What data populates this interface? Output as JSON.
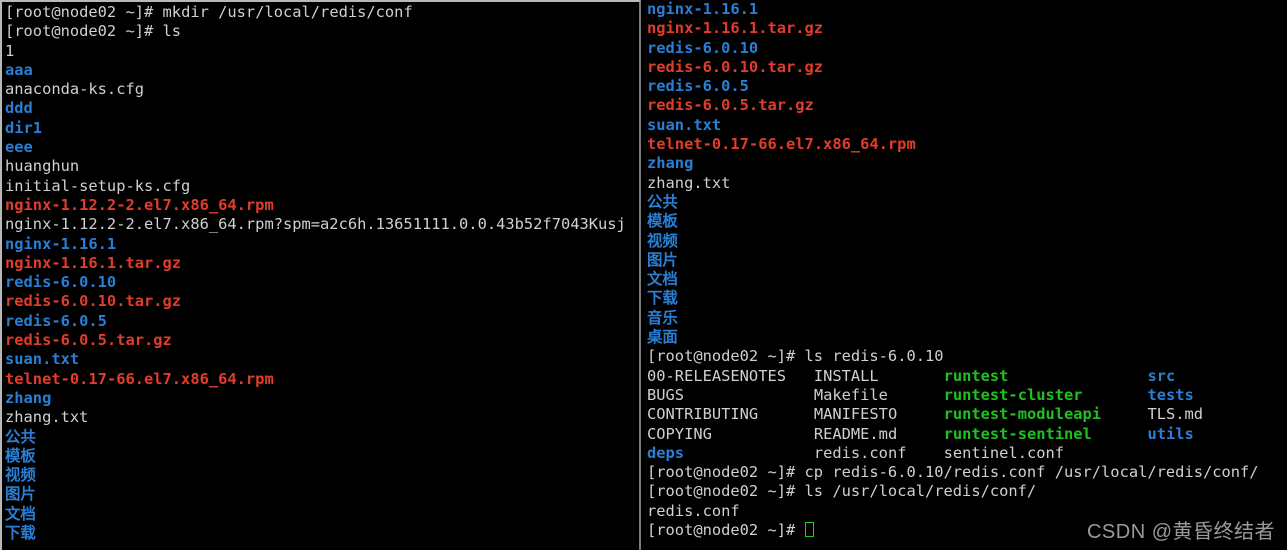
{
  "terminal": {
    "prompt": "[root@node02 ~]# ",
    "colors": {
      "background": "#000000",
      "foreground": "#d0d0d0",
      "directory": "#2a7fd4",
      "archive": "#e23c2c",
      "executable": "#20c020",
      "cursor": "#1ecc1e",
      "divider": "#b8b8b8"
    }
  },
  "watermark": "CSDN @黄昏终结者",
  "left_pane": {
    "lines": [
      {
        "type": "command",
        "prompt": "[root@node02 ~]# ",
        "command": "mkdir /usr/local/redis/conf"
      },
      {
        "type": "command",
        "prompt": "[root@node02 ~]# ",
        "command": "ls"
      },
      {
        "type": "entry",
        "text": "1",
        "color": "white"
      },
      {
        "type": "entry",
        "text": "aaa",
        "color": "dir"
      },
      {
        "type": "entry",
        "text": "anaconda-ks.cfg",
        "color": "white"
      },
      {
        "type": "entry",
        "text": "ddd",
        "color": "dir"
      },
      {
        "type": "entry",
        "text": "dir1",
        "color": "dir"
      },
      {
        "type": "entry",
        "text": "eee",
        "color": "dir"
      },
      {
        "type": "entry",
        "text": "huanghun",
        "color": "white"
      },
      {
        "type": "entry",
        "text": "initial-setup-ks.cfg",
        "color": "white"
      },
      {
        "type": "entry",
        "text": "nginx-1.12.2-2.el7.x86_64.rpm",
        "color": "arch"
      },
      {
        "type": "entry",
        "text": "nginx-1.12.2-2.el7.x86_64.rpm?spm=a2c6h.13651111.0.0.43b52f7043Kusj",
        "color": "white"
      },
      {
        "type": "entry",
        "text": "nginx-1.16.1",
        "color": "dir"
      },
      {
        "type": "entry",
        "text": "nginx-1.16.1.tar.gz",
        "color": "arch"
      },
      {
        "type": "entry",
        "text": "redis-6.0.10",
        "color": "dir"
      },
      {
        "type": "entry",
        "text": "redis-6.0.10.tar.gz",
        "color": "arch"
      },
      {
        "type": "entry",
        "text": "redis-6.0.5",
        "color": "dir"
      },
      {
        "type": "entry",
        "text": "redis-6.0.5.tar.gz",
        "color": "arch"
      },
      {
        "type": "entry",
        "text": "suan.txt",
        "color": "dir"
      },
      {
        "type": "entry",
        "text": "telnet-0.17-66.el7.x86_64.rpm",
        "color": "arch"
      },
      {
        "type": "entry",
        "text": "zhang",
        "color": "dir"
      },
      {
        "type": "entry",
        "text": "zhang.txt",
        "color": "white"
      },
      {
        "type": "entry",
        "text": "公共",
        "color": "dir"
      },
      {
        "type": "entry",
        "text": "模板",
        "color": "dir"
      },
      {
        "type": "entry",
        "text": "视频",
        "color": "dir"
      },
      {
        "type": "entry",
        "text": "图片",
        "color": "dir"
      },
      {
        "type": "entry",
        "text": "文档",
        "color": "dir"
      },
      {
        "type": "entry",
        "text": "下载",
        "color": "dir"
      }
    ]
  },
  "right_pane": {
    "lines": [
      {
        "type": "entry",
        "text": "nginx-1.16.1",
        "color": "dir"
      },
      {
        "type": "entry",
        "text": "nginx-1.16.1.tar.gz",
        "color": "arch"
      },
      {
        "type": "entry",
        "text": "redis-6.0.10",
        "color": "dir"
      },
      {
        "type": "entry",
        "text": "redis-6.0.10.tar.gz",
        "color": "arch"
      },
      {
        "type": "entry",
        "text": "redis-6.0.5",
        "color": "dir"
      },
      {
        "type": "entry",
        "text": "redis-6.0.5.tar.gz",
        "color": "arch"
      },
      {
        "type": "entry",
        "text": "suan.txt",
        "color": "dir"
      },
      {
        "type": "entry",
        "text": "telnet-0.17-66.el7.x86_64.rpm",
        "color": "arch"
      },
      {
        "type": "entry",
        "text": "zhang",
        "color": "dir"
      },
      {
        "type": "entry",
        "text": "zhang.txt",
        "color": "white"
      },
      {
        "type": "entry",
        "text": "公共",
        "color": "dir"
      },
      {
        "type": "entry",
        "text": "模板",
        "color": "dir"
      },
      {
        "type": "entry",
        "text": "视频",
        "color": "dir"
      },
      {
        "type": "entry",
        "text": "图片",
        "color": "dir"
      },
      {
        "type": "entry",
        "text": "文档",
        "color": "dir"
      },
      {
        "type": "entry",
        "text": "下载",
        "color": "dir"
      },
      {
        "type": "entry",
        "text": "音乐",
        "color": "dir"
      },
      {
        "type": "entry",
        "text": "桌面",
        "color": "dir"
      },
      {
        "type": "command",
        "prompt": "[root@node02 ~]# ",
        "command": "ls redis-6.0.10"
      },
      {
        "type": "columns",
        "cells": [
          {
            "text": "00-RELEASENOTES",
            "color": "white",
            "col": 0
          },
          {
            "text": "INSTALL",
            "color": "white",
            "col": 18
          },
          {
            "text": "runtest",
            "color": "exec",
            "col": 32
          },
          {
            "text": "src",
            "color": "dir",
            "col": 54
          }
        ]
      },
      {
        "type": "columns",
        "cells": [
          {
            "text": "BUGS",
            "color": "white",
            "col": 0
          },
          {
            "text": "Makefile",
            "color": "white",
            "col": 18
          },
          {
            "text": "runtest-cluster",
            "color": "exec",
            "col": 32
          },
          {
            "text": "tests",
            "color": "dir",
            "col": 54
          }
        ]
      },
      {
        "type": "columns",
        "cells": [
          {
            "text": "CONTRIBUTING",
            "color": "white",
            "col": 0
          },
          {
            "text": "MANIFESTO",
            "color": "white",
            "col": 18
          },
          {
            "text": "runtest-moduleapi",
            "color": "exec",
            "col": 32
          },
          {
            "text": "TLS.md",
            "color": "white",
            "col": 54
          }
        ]
      },
      {
        "type": "columns",
        "cells": [
          {
            "text": "COPYING",
            "color": "white",
            "col": 0
          },
          {
            "text": "README.md",
            "color": "white",
            "col": 18
          },
          {
            "text": "runtest-sentinel",
            "color": "exec",
            "col": 32
          },
          {
            "text": "utils",
            "color": "dir",
            "col": 54
          }
        ]
      },
      {
        "type": "columns",
        "cells": [
          {
            "text": "deps",
            "color": "dir",
            "col": 0
          },
          {
            "text": "redis.conf",
            "color": "white",
            "col": 18
          },
          {
            "text": "sentinel.conf",
            "color": "white",
            "col": 32
          }
        ]
      },
      {
        "type": "command",
        "prompt": "[root@node02 ~]# ",
        "command": "cp redis-6.0.10/redis.conf /usr/local/redis/conf/"
      },
      {
        "type": "command",
        "prompt": "[root@node02 ~]# ",
        "command": "ls /usr/local/redis/conf/"
      },
      {
        "type": "entry",
        "text": "redis.conf",
        "color": "white"
      },
      {
        "type": "cursorline",
        "prompt": "[root@node02 ~]# ",
        "command": ""
      }
    ]
  }
}
